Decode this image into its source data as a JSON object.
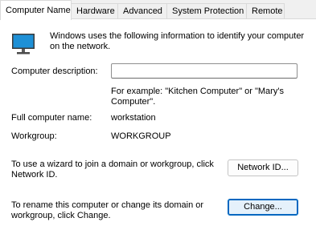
{
  "tabs": [
    {
      "label": "Computer Name"
    },
    {
      "label": "Hardware"
    },
    {
      "label": "Advanced"
    },
    {
      "label": "System Protection"
    },
    {
      "label": "Remote"
    }
  ],
  "intro_text": "Windows uses the following information to identify your computer on the network.",
  "description": {
    "label": "Computer description:",
    "value": "",
    "example_text": "For example: \"Kitchen Computer\" or \"Mary's Computer\"."
  },
  "full_name": {
    "label": "Full computer name:",
    "value": "workstation"
  },
  "workgroup": {
    "label": "Workgroup:",
    "value": "WORKGROUP"
  },
  "network_id": {
    "text": "To use a wizard to join a domain or workgroup, click Network ID.",
    "button_label": "Network ID..."
  },
  "change": {
    "text": "To rename this computer or change its domain or workgroup, click Change.",
    "button_label": "Change..."
  },
  "colors": {
    "monitor_screen": "#1e90d6",
    "focus_border": "#0067c0"
  },
  "icons": {
    "computer": "monitor-icon"
  }
}
